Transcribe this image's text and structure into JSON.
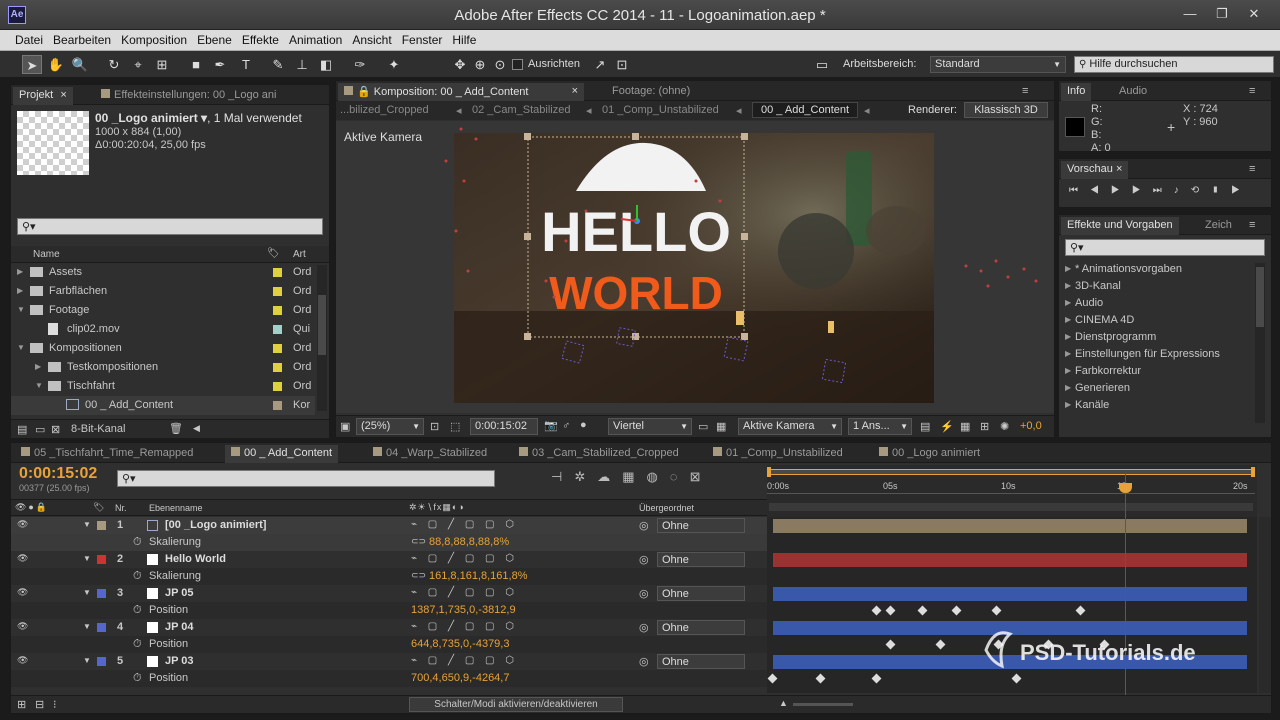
{
  "window": {
    "title": "Adobe After Effects CC 2014 - 11 - Logoanimation.aep *",
    "app_badge": "Ae"
  },
  "menu": [
    "Datei",
    "Bearbeiten",
    "Komposition",
    "Ebene",
    "Effekte",
    "Animation",
    "Ansicht",
    "Fenster",
    "Hilfe"
  ],
  "toolbar": {
    "ausrichten": "Ausrichten",
    "arbeitsbereich_label": "Arbeitsbereich:",
    "arbeitsbereich_value": "Standard",
    "help_search": "Hilfe durchsuchen"
  },
  "project": {
    "tab": "Projekt",
    "tab2": "Effekteinstellungen: 00 _Logo ani",
    "item_name": "00 _Logo animiert ▾",
    "item_usage": ", 1 Mal verwendet",
    "item_dims": "1000 x 884 (1,00)",
    "item_duration": "Δ0:00:20:04, 25,00 fps",
    "col_name": "Name",
    "col_type": "Art",
    "bit_depth": "8-Bit-Kanal",
    "items": [
      {
        "name": "Assets",
        "type": "Ord",
        "color": "#e0d040",
        "level": 0,
        "kind": "folder",
        "arrow": "▶"
      },
      {
        "name": "Farbflächen",
        "type": "Ord",
        "color": "#e0d040",
        "level": 0,
        "kind": "folder",
        "arrow": "▶"
      },
      {
        "name": "Footage",
        "type": "Ord",
        "color": "#e0d040",
        "level": 0,
        "kind": "folder",
        "arrow": "▼"
      },
      {
        "name": "clip02.mov",
        "type": "Qui",
        "color": "#a0d0c8",
        "level": 1,
        "kind": "file",
        "arrow": ""
      },
      {
        "name": "Kompositionen",
        "type": "Ord",
        "color": "#e0d040",
        "level": 0,
        "kind": "folder",
        "arrow": "▼"
      },
      {
        "name": "Testkompositionen",
        "type": "Ord",
        "color": "#e0d040",
        "level": 1,
        "kind": "folder",
        "arrow": "▶"
      },
      {
        "name": "Tischfahrt",
        "type": "Ord",
        "color": "#e0d040",
        "level": 1,
        "kind": "folder",
        "arrow": "▼"
      },
      {
        "name": "00 _ Add_Content",
        "type": "Kor",
        "color": "#a89a80",
        "level": 2,
        "kind": "comp",
        "arrow": ""
      }
    ]
  },
  "composition": {
    "tab": "Komposition: 00 _ Add_Content",
    "footage_tab": "Footage: (ohne)",
    "breadcrumbs": [
      "...bilized_Cropped",
      "02 _Cam_Stabilized",
      "01 _Comp_Unstabilized",
      "00 _ Add_Content"
    ],
    "renderer_label": "Renderer:",
    "renderer_value": "Klassisch 3D",
    "view_label": "Aktive Kamera",
    "zoom": "(25%)",
    "time": "0:00:15:02",
    "resolution": "Viertel",
    "camera": "Aktive Kamera",
    "views": "1 Ans...",
    "offset": "+0,0",
    "logo_line1": "HELLO",
    "logo_line2": "WORLD"
  },
  "info": {
    "tab": "Info",
    "tab2": "Audio",
    "r": "R:",
    "g": "G:",
    "b": "B:",
    "a": "A:  0",
    "x": "X : 724",
    "y": "Y : 960"
  },
  "preview": {
    "tab": "Vorschau"
  },
  "effects": {
    "tab": "Effekte und Vorgaben",
    "tab2": "Zeich",
    "items": [
      "* Animationsvorgaben",
      "3D-Kanal",
      "Audio",
      "CINEMA 4D",
      "Dienstprogramm",
      "Einstellungen für Expressions",
      "Farbkorrektur",
      "Generieren",
      "Kanäle"
    ]
  },
  "timeline": {
    "tabs": [
      "05 _Tischfahrt_Time_Remapped",
      "00 _ Add_Content",
      "04 _Warp_Stabilized",
      "03 _Cam_Stabilized_Cropped",
      "01 _Comp_Unstabilized",
      "00 _Logo animiert"
    ],
    "timecode": "0:00:15:02",
    "frames": "00377 (25.00 fps)",
    "col_nr": "Nr.",
    "col_name": "Ebenenname",
    "col_parent": "Übergeordnet",
    "ruler": [
      "0:00s",
      "05s",
      "10s",
      "15s",
      "20s"
    ],
    "footer": "Schalter/Modi aktivieren/deaktivieren",
    "layers": [
      {
        "nr": "1",
        "name": "[00 _Logo animiert]",
        "color": "#a89a80",
        "parent": "Ohne",
        "prop": "Skalierung",
        "value": "88,8,88,8,88,8%",
        "bar": "#8a7a62"
      },
      {
        "nr": "2",
        "name": "Hello World",
        "color": "#cc3333",
        "parent": "Ohne",
        "prop": "Skalierung",
        "value": "161,8,161,8,161,8%",
        "bar": "#9a3232"
      },
      {
        "nr": "3",
        "name": "JP 05",
        "color": "#5566cc",
        "parent": "Ohne",
        "prop": "Position",
        "value": "1387,1,735,0,-3812,9",
        "bar": "#3a58aa"
      },
      {
        "nr": "4",
        "name": "JP 04",
        "color": "#5566cc",
        "parent": "Ohne",
        "prop": "Position",
        "value": "644,8,735,0,-4379,3",
        "bar": "#3a58aa"
      },
      {
        "nr": "5",
        "name": "JP 03",
        "color": "#5566cc",
        "parent": "Ohne",
        "prop": "Position",
        "value": "700,4,650,9,-4264,7",
        "bar": "#3a58aa"
      }
    ]
  },
  "watermark": "PSD-Tutorials.de"
}
